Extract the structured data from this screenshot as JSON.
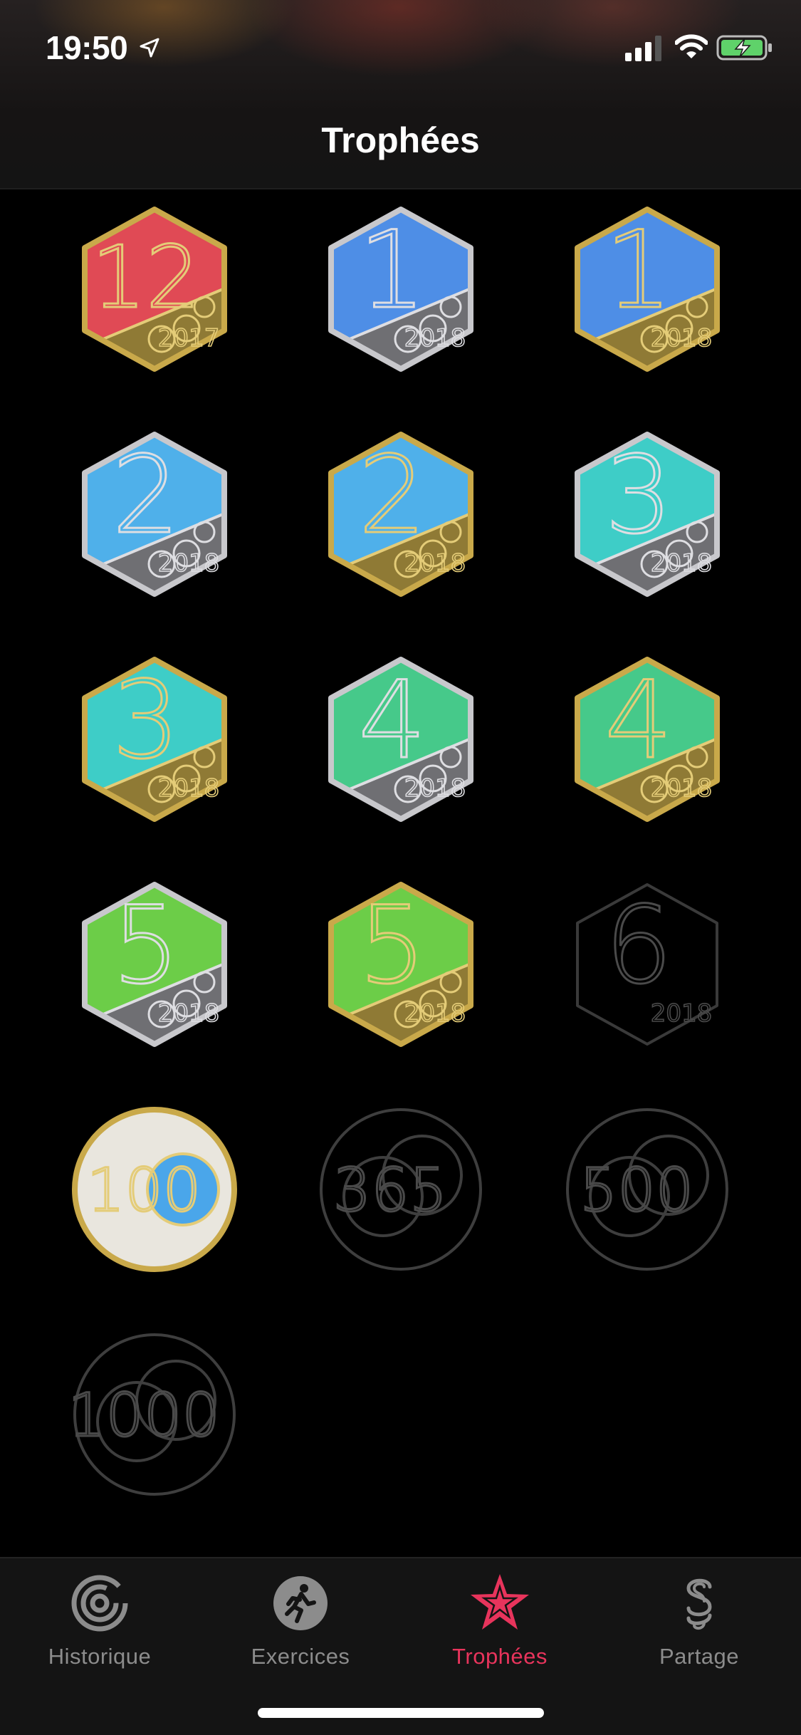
{
  "status_bar": {
    "time": "19:50"
  },
  "header": {
    "title": "Trophées"
  },
  "badges": [
    {
      "label": "12",
      "year": "2017",
      "color": "#e04a55",
      "metal": "gold"
    },
    {
      "label": "1",
      "year": "2018",
      "color": "#4e8ee6",
      "metal": "silver"
    },
    {
      "label": "1",
      "year": "2018",
      "color": "#4e8ee6",
      "metal": "gold"
    },
    {
      "label": "2",
      "year": "2018",
      "color": "#4fb0ea",
      "metal": "silver"
    },
    {
      "label": "2",
      "year": "2018",
      "color": "#4fb0ea",
      "metal": "gold"
    },
    {
      "label": "3",
      "year": "2018",
      "color": "#3ecdc7",
      "metal": "silver"
    },
    {
      "label": "3",
      "year": "2018",
      "color": "#3ecdc7",
      "metal": "gold"
    },
    {
      "label": "4",
      "year": "2018",
      "color": "#46c98a",
      "metal": "silver"
    },
    {
      "label": "4",
      "year": "2018",
      "color": "#46c98a",
      "metal": "gold"
    },
    {
      "label": "5",
      "year": "2018",
      "color": "#6ccd48",
      "metal": "silver"
    },
    {
      "label": "5",
      "year": "2018",
      "color": "#6ccd48",
      "metal": "gold"
    },
    {
      "label": "6",
      "year": "2018",
      "color": "",
      "metal": "locked"
    },
    {
      "label": "100",
      "year": "",
      "color": "#4aa6ea",
      "metal": "gold-round"
    },
    {
      "label": "365",
      "year": "",
      "color": "",
      "metal": "locked-round"
    },
    {
      "label": "500",
      "year": "",
      "color": "",
      "metal": "locked-round"
    },
    {
      "label": "1000",
      "year": "",
      "color": "",
      "metal": "locked-round"
    }
  ],
  "tabbar": {
    "items": [
      {
        "label": "Historique",
        "icon": "rings-history-icon",
        "active": false
      },
      {
        "label": "Exercices",
        "icon": "running-figure-icon",
        "active": false
      },
      {
        "label": "Trophées",
        "icon": "star-trophy-icon",
        "active": true
      },
      {
        "label": "Partage",
        "icon": "sharing-icon",
        "active": false
      }
    ],
    "active_color": "#e8345c",
    "inactive_color": "#8c8c8c"
  }
}
